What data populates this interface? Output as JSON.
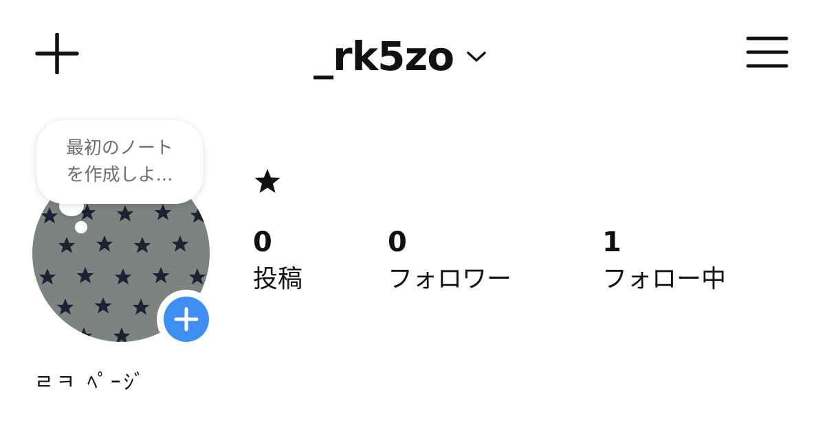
{
  "header": {
    "username": "_rk5zo"
  },
  "note": {
    "line1": "最初のノート",
    "line2": "を作成しよ..."
  },
  "bio": {
    "text": "★"
  },
  "stats": {
    "posts": {
      "count": "0",
      "label": "投稿"
    },
    "followers": {
      "count": "0",
      "label": "フォロワー"
    },
    "following": {
      "count": "1",
      "label": "フォロー中"
    }
  },
  "page_name": "ㄹㅋ ﾍﾟｰｼﾞ",
  "icons": {
    "add_post": "plus-icon",
    "username_menu": "chevron-down-icon",
    "main_menu": "hamburger-menu-icon",
    "avatar_add": "plus-circle-icon",
    "bio": "star-icon"
  },
  "colors": {
    "text": "#111111",
    "note_text": "#6f6f6f",
    "accent_blue": "#3f8ff2",
    "avatar_gray": "#7d837f",
    "star_navy": "#1c2233"
  }
}
